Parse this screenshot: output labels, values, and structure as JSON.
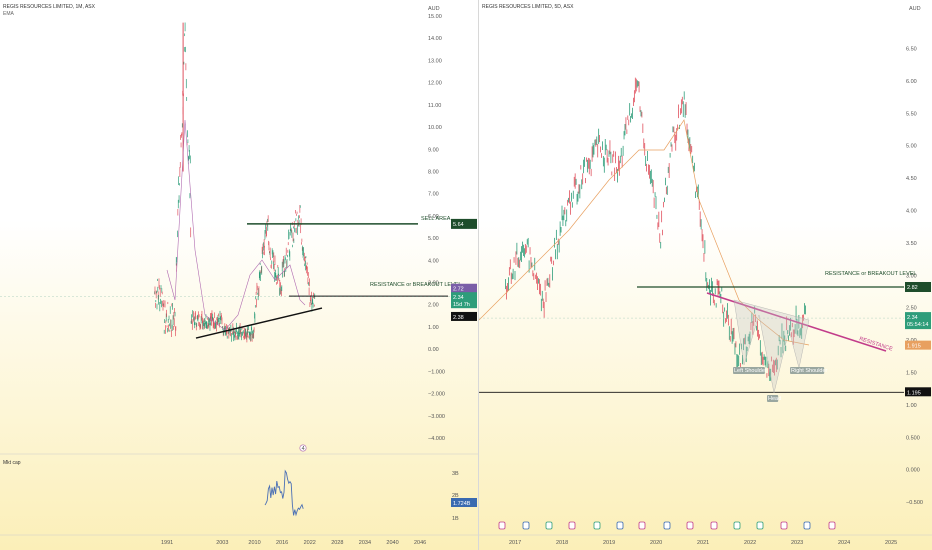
{
  "left_chart": {
    "title": "REGIS RESOURCES LIMITED, 1M, ASX",
    "indicator": "EMA",
    "currency": "AUD",
    "y_ticks": [
      "15.00",
      "14.00",
      "13.00",
      "12.00",
      "11.00",
      "10.00",
      "9.00",
      "8.00",
      "7.00",
      "6.00",
      "5.00",
      "4.00",
      "3.00",
      "2.00",
      "1.00",
      "0.00",
      "−1.000",
      "−2.000",
      "−3.000",
      "−4.000"
    ],
    "x_ticks": [
      "1991",
      "2003",
      "2010",
      "2016",
      "2022",
      "2028",
      "2034",
      "2040",
      "2046"
    ],
    "sell_label": "SELL AREA",
    "sell_price": "5.64",
    "resistance_label": "RESISTANCE or BREAKOUT LEVEL",
    "price_tags": [
      "2.72",
      "2.34",
      "15d 7h",
      "2.38"
    ],
    "subpane_label": "Mkt cap",
    "subpane_ticks": [
      "3B",
      "2B",
      "1B"
    ],
    "subpane_value": "1.724B",
    "marker": "4"
  },
  "right_chart": {
    "title": "REGIS RESOURCES LIMITED, 5D, ASX",
    "currency": "AUD",
    "y_ticks": [
      "6.50",
      "6.00",
      "5.50",
      "5.00",
      "4.50",
      "4.00",
      "3.50",
      "3.00",
      "2.50",
      "2.00",
      "1.50",
      "1.00",
      "0.500",
      "0.000",
      "−0.500"
    ],
    "x_ticks": [
      "2017",
      "2018",
      "2019",
      "2020",
      "2021",
      "2022",
      "2023",
      "2024",
      "2025"
    ],
    "resistance_label": "RESISTANCE or BREAKOUT LEVEL",
    "resistance_price": "2.82",
    "trendline_label": "RESISTANCE",
    "current_price": "2.34",
    "countdown": "05:54:14",
    "ema_value": "1.915",
    "support_price": "1.195",
    "pattern_labels": [
      "Left Shoulder",
      "Head",
      "Right Shoulder"
    ]
  },
  "chart_data": [
    {
      "type": "line",
      "title": "REGIS RESOURCES LIMITED, 1M, ASX",
      "ylabel": "AUD",
      "ylim": [
        -4.0,
        15.0
      ],
      "x": [
        2004,
        2005,
        2006,
        2007,
        2008,
        2009,
        2010,
        2011,
        2012,
        2013,
        2014,
        2015,
        2016,
        2017,
        2018,
        2019,
        2020,
        2021,
        2022,
        2023
      ],
      "series": [
        {
          "name": "",
          "values": [
            0.9,
            0.7,
            0.5,
            0.6,
            0.4,
            0.2,
            0.4,
            2.5,
            3.9,
            5.5,
            2.8,
            1.8,
            2.6,
            3.8,
            4.6,
            5.2,
            5.8,
            4.0,
            2.0,
            2.34
          ]
        }
      ],
      "levels": {
        "sell_area": 5.64,
        "resistance": 2.34,
        "trend_current": 2.38
      }
    },
    {
      "type": "line",
      "title": "REGIS RESOURCES LIMITED, 5D, ASX",
      "ylabel": "AUD",
      "ylim": [
        -0.5,
        6.5
      ],
      "x": [
        2016.8,
        2017.2,
        2017.6,
        2018.0,
        2018.4,
        2018.8,
        2019.2,
        2019.6,
        2019.8,
        2020.1,
        2020.3,
        2020.6,
        2020.9,
        2021.1,
        2021.4,
        2021.8,
        2022.1,
        2022.4,
        2022.7,
        2022.9,
        2023.2
      ],
      "series": [
        {
          "name": "",
          "values": [
            2.8,
            3.5,
            2.6,
            3.8,
            4.5,
            5.0,
            4.6,
            6.0,
            4.8,
            3.6,
            4.9,
            5.7,
            4.1,
            2.9,
            2.6,
            1.7,
            2.3,
            1.4,
            2.0,
            2.2,
            2.34
          ]
        }
      ],
      "levels": {
        "resistance": 2.82,
        "support": 1.195,
        "current": 2.34,
        "ema": 1.915
      }
    }
  ]
}
